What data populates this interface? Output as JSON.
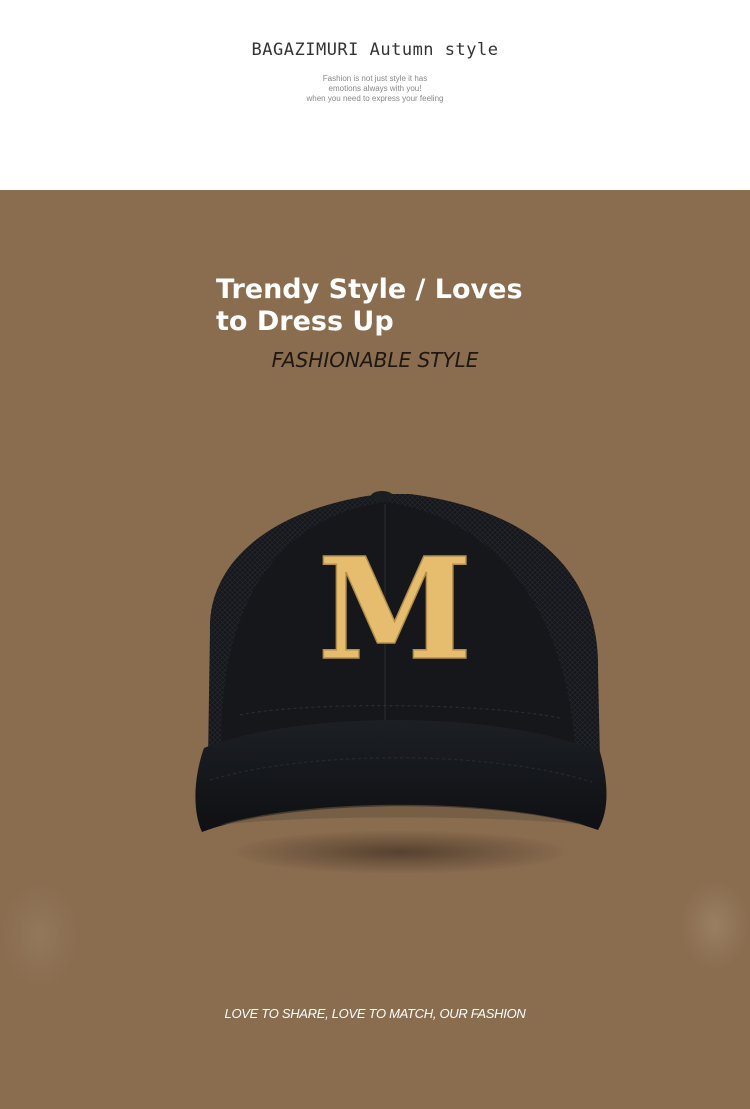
{
  "header": {
    "brand_title": "BAGAZIMURI Autumn style",
    "tagline_lines": [
      "Fashion is not just style it has",
      "emotions always with you!",
      "when you need to express your feeling"
    ]
  },
  "hero": {
    "headline": "Trendy Style / Loves to Dress Up",
    "subheadline": "FASHIONABLE STYLE",
    "footer_text": "LOVE TO SHARE, LOVE TO MATCH, OUR FASHION",
    "background_color": "#8a6c4f"
  },
  "product": {
    "cap_color": "#15171b",
    "emblem_color": "#e6bd6e",
    "emblem_letter": "M"
  }
}
